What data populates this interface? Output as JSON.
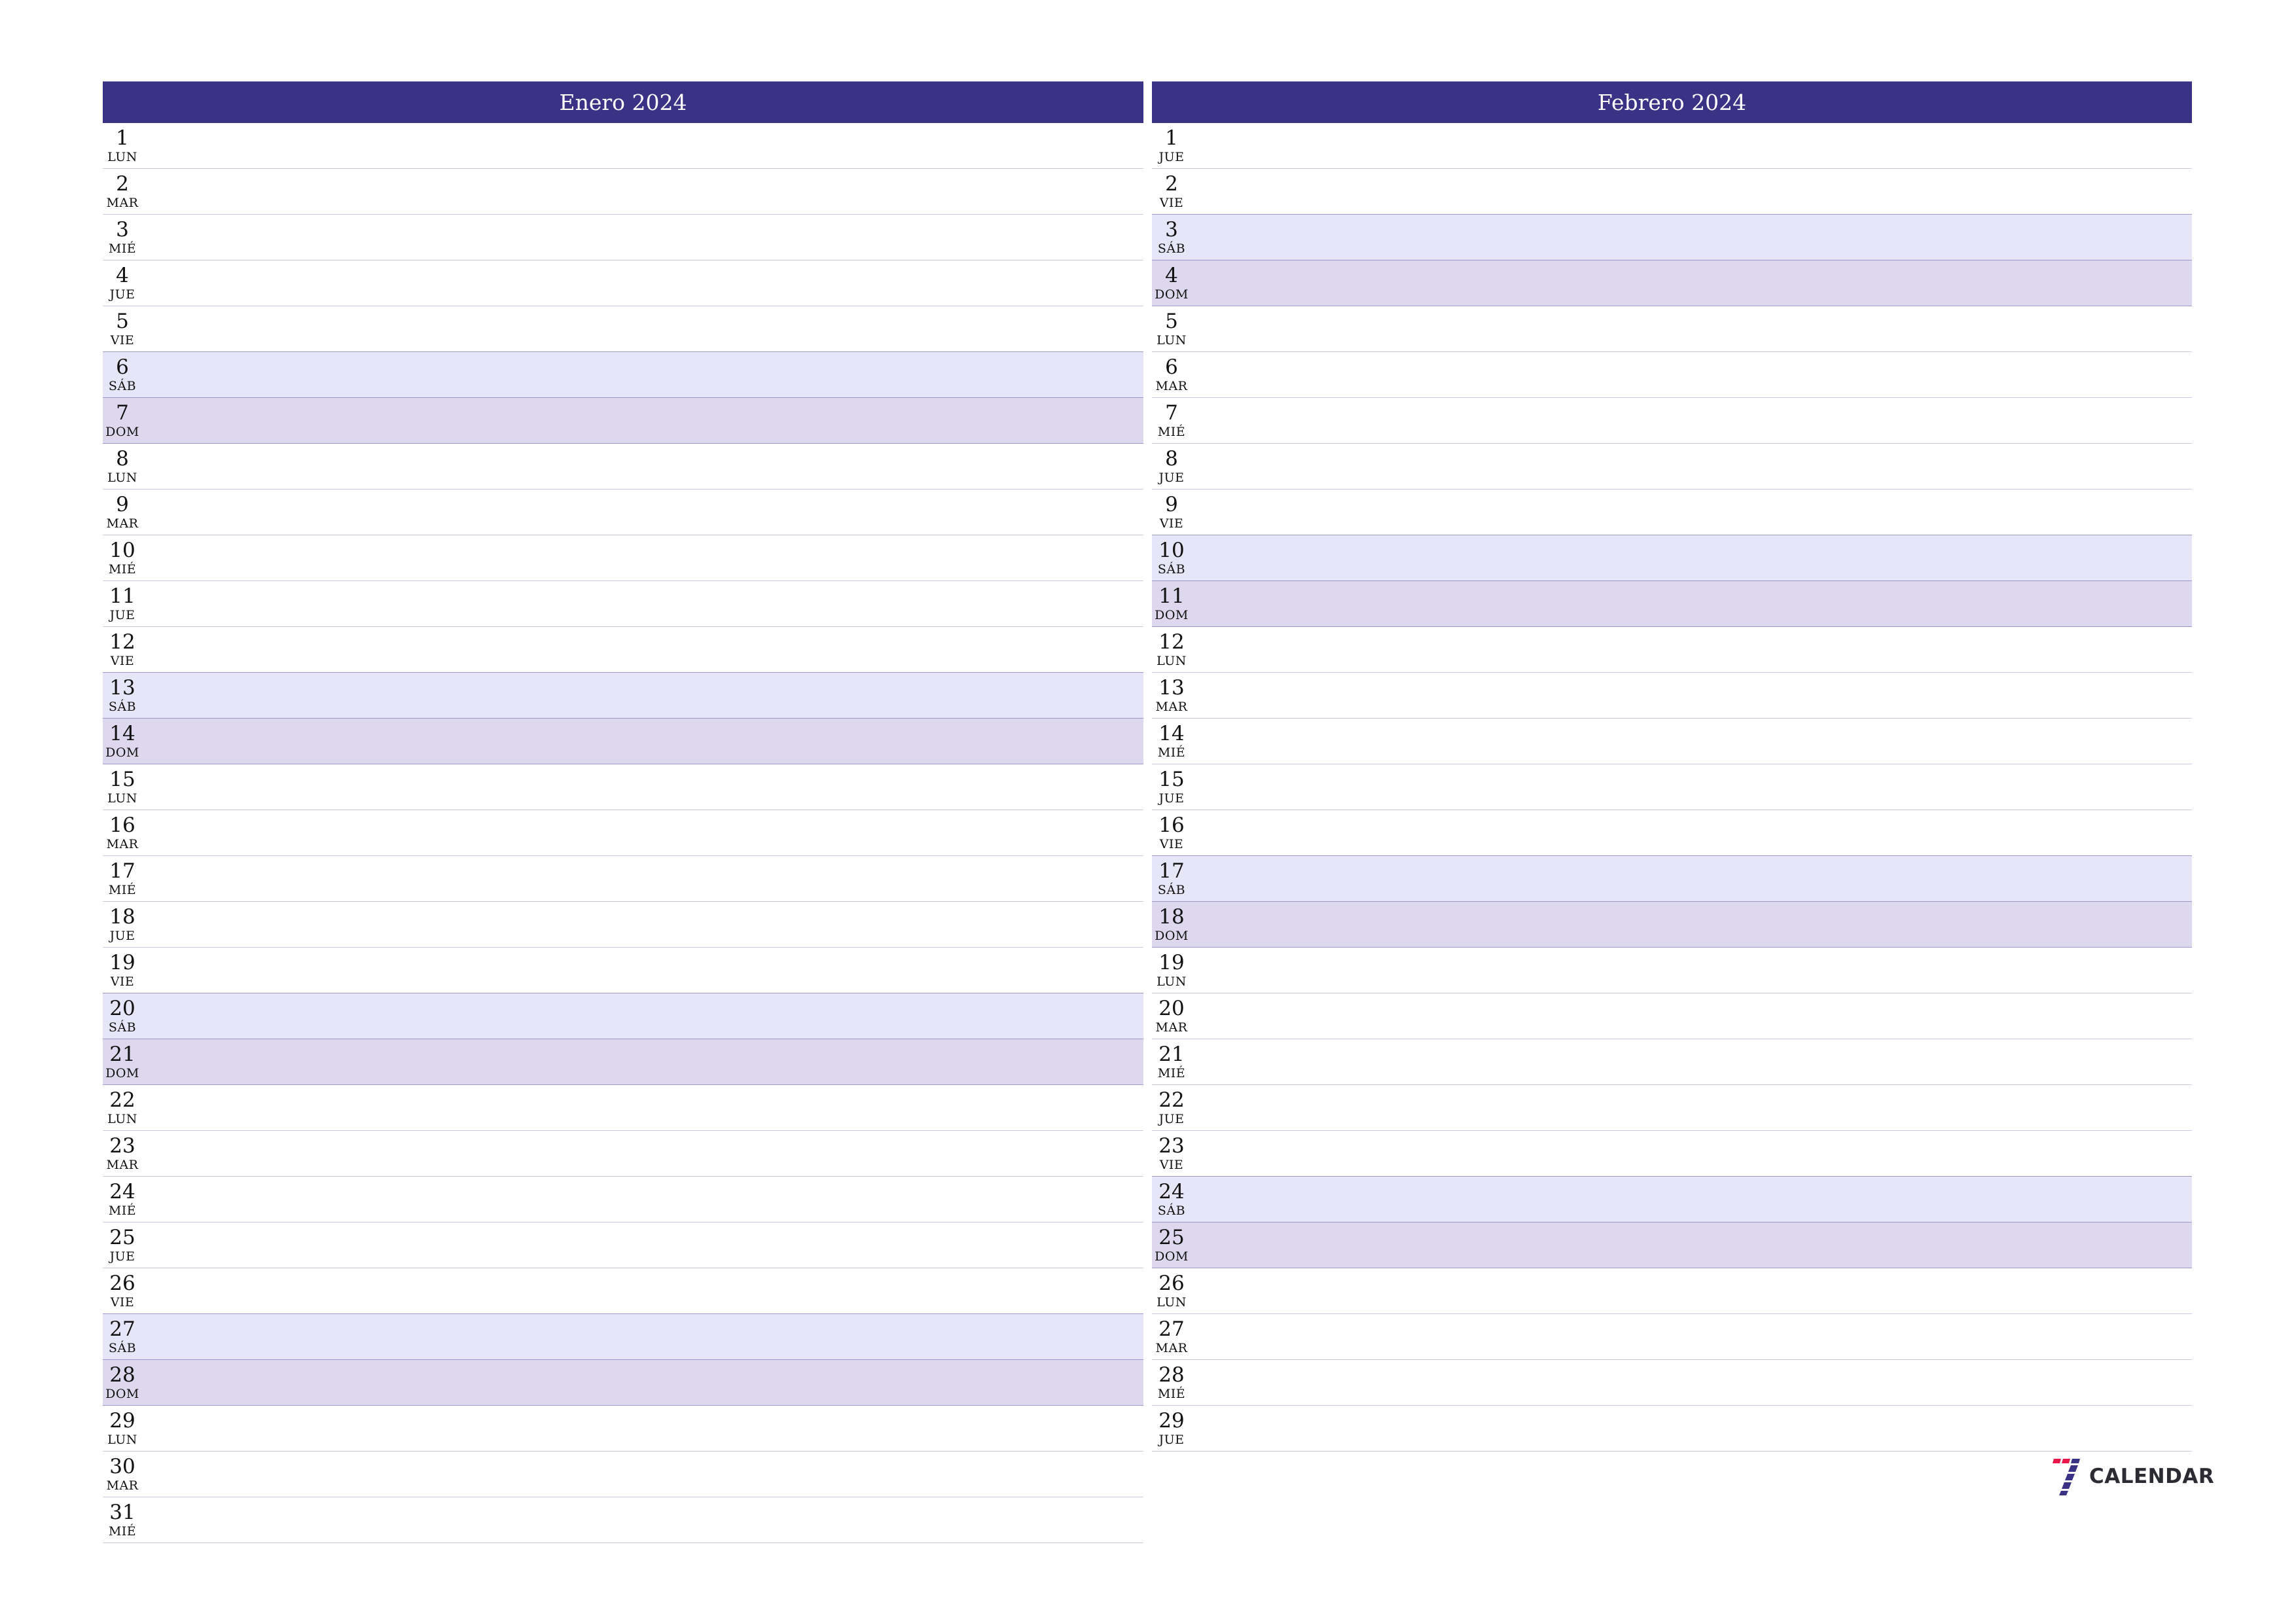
{
  "months": [
    {
      "title": "Enero 2024",
      "days": [
        {
          "num": "1",
          "name": "LUN",
          "type": "weekday"
        },
        {
          "num": "2",
          "name": "MAR",
          "type": "weekday"
        },
        {
          "num": "3",
          "name": "MIÉ",
          "type": "weekday"
        },
        {
          "num": "4",
          "name": "JUE",
          "type": "weekday"
        },
        {
          "num": "5",
          "name": "VIE",
          "type": "weekday"
        },
        {
          "num": "6",
          "name": "SÁB",
          "type": "sat"
        },
        {
          "num": "7",
          "name": "DOM",
          "type": "sun"
        },
        {
          "num": "8",
          "name": "LUN",
          "type": "weekday"
        },
        {
          "num": "9",
          "name": "MAR",
          "type": "weekday"
        },
        {
          "num": "10",
          "name": "MIÉ",
          "type": "weekday"
        },
        {
          "num": "11",
          "name": "JUE",
          "type": "weekday"
        },
        {
          "num": "12",
          "name": "VIE",
          "type": "weekday"
        },
        {
          "num": "13",
          "name": "SÁB",
          "type": "sat"
        },
        {
          "num": "14",
          "name": "DOM",
          "type": "sun"
        },
        {
          "num": "15",
          "name": "LUN",
          "type": "weekday"
        },
        {
          "num": "16",
          "name": "MAR",
          "type": "weekday"
        },
        {
          "num": "17",
          "name": "MIÉ",
          "type": "weekday"
        },
        {
          "num": "18",
          "name": "JUE",
          "type": "weekday"
        },
        {
          "num": "19",
          "name": "VIE",
          "type": "weekday"
        },
        {
          "num": "20",
          "name": "SÁB",
          "type": "sat"
        },
        {
          "num": "21",
          "name": "DOM",
          "type": "sun"
        },
        {
          "num": "22",
          "name": "LUN",
          "type": "weekday"
        },
        {
          "num": "23",
          "name": "MAR",
          "type": "weekday"
        },
        {
          "num": "24",
          "name": "MIÉ",
          "type": "weekday"
        },
        {
          "num": "25",
          "name": "JUE",
          "type": "weekday"
        },
        {
          "num": "26",
          "name": "VIE",
          "type": "weekday"
        },
        {
          "num": "27",
          "name": "SÁB",
          "type": "sat"
        },
        {
          "num": "28",
          "name": "DOM",
          "type": "sun"
        },
        {
          "num": "29",
          "name": "LUN",
          "type": "weekday"
        },
        {
          "num": "30",
          "name": "MAR",
          "type": "weekday"
        },
        {
          "num": "31",
          "name": "MIÉ",
          "type": "weekday"
        }
      ]
    },
    {
      "title": "Febrero 2024",
      "days": [
        {
          "num": "1",
          "name": "JUE",
          "type": "weekday"
        },
        {
          "num": "2",
          "name": "VIE",
          "type": "weekday"
        },
        {
          "num": "3",
          "name": "SÁB",
          "type": "sat"
        },
        {
          "num": "4",
          "name": "DOM",
          "type": "sun"
        },
        {
          "num": "5",
          "name": "LUN",
          "type": "weekday"
        },
        {
          "num": "6",
          "name": "MAR",
          "type": "weekday"
        },
        {
          "num": "7",
          "name": "MIÉ",
          "type": "weekday"
        },
        {
          "num": "8",
          "name": "JUE",
          "type": "weekday"
        },
        {
          "num": "9",
          "name": "VIE",
          "type": "weekday"
        },
        {
          "num": "10",
          "name": "SÁB",
          "type": "sat"
        },
        {
          "num": "11",
          "name": "DOM",
          "type": "sun"
        },
        {
          "num": "12",
          "name": "LUN",
          "type": "weekday"
        },
        {
          "num": "13",
          "name": "MAR",
          "type": "weekday"
        },
        {
          "num": "14",
          "name": "MIÉ",
          "type": "weekday"
        },
        {
          "num": "15",
          "name": "JUE",
          "type": "weekday"
        },
        {
          "num": "16",
          "name": "VIE",
          "type": "weekday"
        },
        {
          "num": "17",
          "name": "SÁB",
          "type": "sat"
        },
        {
          "num": "18",
          "name": "DOM",
          "type": "sun"
        },
        {
          "num": "19",
          "name": "LUN",
          "type": "weekday"
        },
        {
          "num": "20",
          "name": "MAR",
          "type": "weekday"
        },
        {
          "num": "21",
          "name": "MIÉ",
          "type": "weekday"
        },
        {
          "num": "22",
          "name": "JUE",
          "type": "weekday"
        },
        {
          "num": "23",
          "name": "VIE",
          "type": "weekday"
        },
        {
          "num": "24",
          "name": "SÁB",
          "type": "sat"
        },
        {
          "num": "25",
          "name": "DOM",
          "type": "sun"
        },
        {
          "num": "26",
          "name": "LUN",
          "type": "weekday"
        },
        {
          "num": "27",
          "name": "MAR",
          "type": "weekday"
        },
        {
          "num": "28",
          "name": "MIÉ",
          "type": "weekday"
        },
        {
          "num": "29",
          "name": "JUE",
          "type": "weekday"
        }
      ]
    }
  ],
  "logo": {
    "text": "CALENDAR",
    "icon": "seven-icon",
    "colors": {
      "accent_red": "#e8174a",
      "accent_blue": "#3a3285"
    }
  },
  "colors": {
    "header_bg": "#3a3285",
    "saturday_bg": "#e6e6f8",
    "sunday_bg": "#ddd8ee"
  }
}
